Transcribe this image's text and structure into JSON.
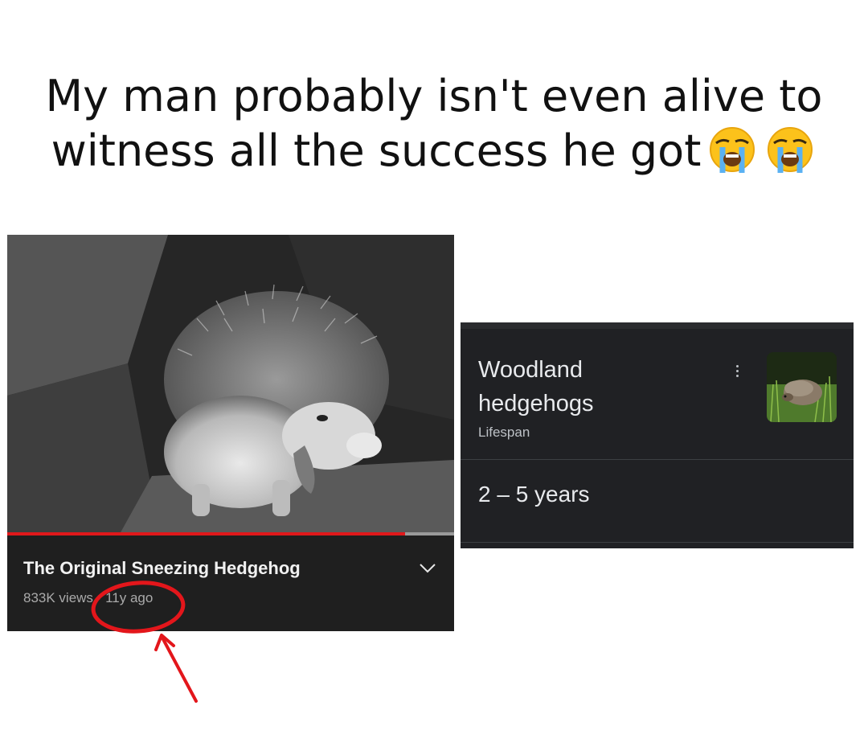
{
  "meme": {
    "caption_line1": "My man probably isn't even alive to",
    "caption_line2": "witness all the success he got",
    "emojis": [
      "loudly-crying-face-emoji",
      "loudly-crying-face-emoji"
    ]
  },
  "video": {
    "title": "The Original Sneezing Hedgehog",
    "views": "833K views",
    "separator": "·",
    "age": "11y ago",
    "progress_fraction": 0.89,
    "progress_color": "#e0181b"
  },
  "knowledge_panel": {
    "title": "Woodland hedgehogs",
    "subtitle": "Lifespan",
    "value": "2 – 5 years"
  },
  "annotation": {
    "circle_color": "#e3161b",
    "arrow_color": "#e3161b"
  }
}
